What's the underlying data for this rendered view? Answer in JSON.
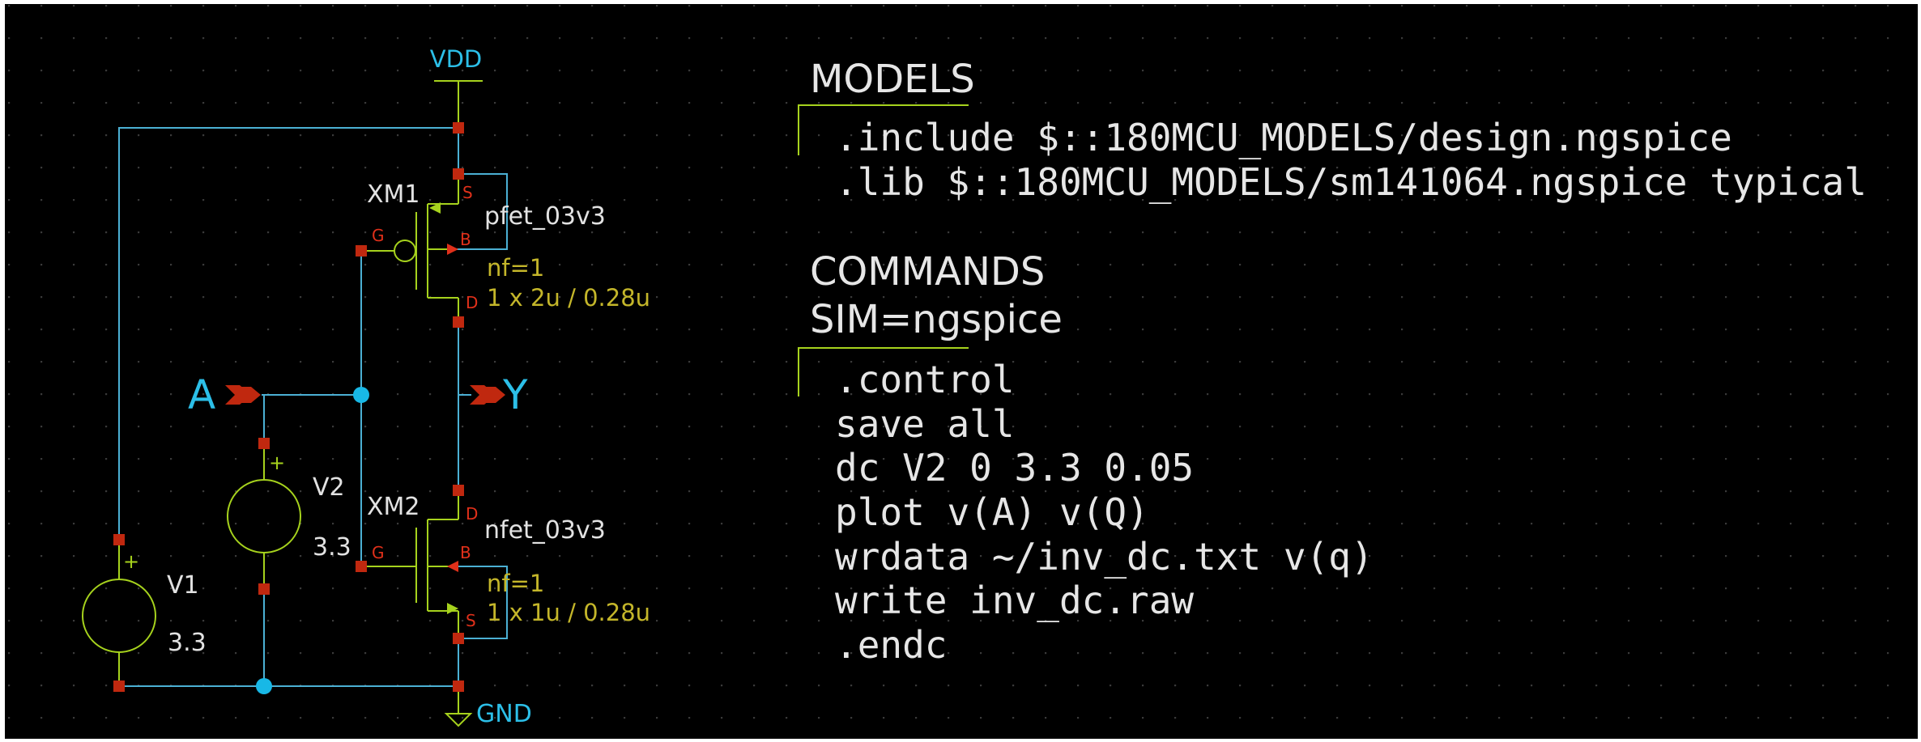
{
  "schematic": {
    "supply_label": "VDD",
    "ground_label": "GND",
    "input_port": "A",
    "output_port": "Y",
    "pmos": {
      "instance": "XM1",
      "model": "pfet_03v3",
      "nf": "nf=1",
      "size": "1 x 2u / 0.28u",
      "pin_s": "S",
      "pin_g": "G",
      "pin_b": "B",
      "pin_d": "D"
    },
    "nmos": {
      "instance": "XM2",
      "model": "nfet_03v3",
      "nf": "nf=1",
      "size": "1 x 1u / 0.28u",
      "pin_d": "D",
      "pin_g": "G",
      "pin_b": "B",
      "pin_s": "S"
    },
    "v1": {
      "name": "V1",
      "value": "3.3",
      "plus": "+"
    },
    "v2": {
      "name": "V2",
      "value": "3.3",
      "plus": "+"
    }
  },
  "models_block": {
    "title": "MODELS",
    "lines": [
      ".include $::180MCU_MODELS/design.ngspice",
      ".lib $::180MCU_MODELS/sm141064.ngspice typical"
    ]
  },
  "commands_block": {
    "title": "COMMANDS",
    "sim": "SIM=ngspice",
    "lines": [
      ".control",
      "save all",
      "dc V2 0 3.3 0.05",
      "plot v(A) v(Q)",
      "wrdata ~/inv_dc.txt v(q)",
      "write inv_dc.raw",
      ".endc"
    ]
  },
  "colors": {
    "background": "#000000",
    "wire": "#4bb0d4",
    "device": "#a6d21d",
    "pin": "#c0280f",
    "label_cyan": "#2cbfe8"
  }
}
